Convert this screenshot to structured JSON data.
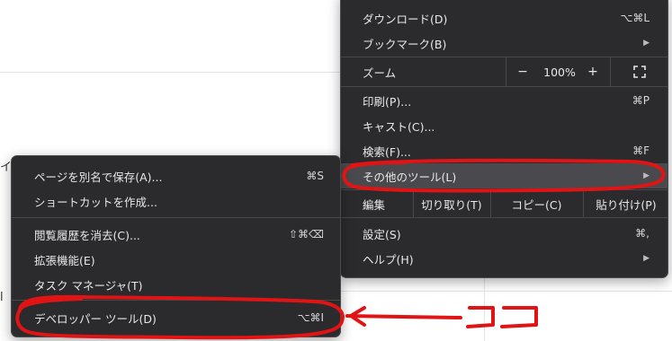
{
  "main_menu": {
    "download": {
      "label": "ダウンロード(D)",
      "shortcut": "⌥⌘L"
    },
    "bookmarks": {
      "label": "ブックマーク(B)"
    },
    "zoom": {
      "label": "ズーム",
      "minus": "−",
      "value": "100%",
      "plus": "+"
    },
    "print": {
      "label": "印刷(P)...",
      "shortcut": "⌘P"
    },
    "cast": {
      "label": "キャスト(C)..."
    },
    "search": {
      "label": "検索(F)...",
      "shortcut": "⌘F"
    },
    "more_tools": {
      "label": "その他のツール(L)"
    },
    "edit": {
      "label": "編集",
      "cut": "切り取り(T)",
      "copy": "コピー(C)",
      "paste": "貼り付け(P)"
    },
    "settings": {
      "label": "設定(S)",
      "shortcut": "⌘,"
    },
    "help": {
      "label": "ヘルプ(H)"
    }
  },
  "sub_menu": {
    "save_page": {
      "label": "ページを別名で保存(A)...",
      "shortcut": "⌘S"
    },
    "create_shortcut": {
      "label": "ショートカットを作成..."
    },
    "clear_history": {
      "label": "閲覧履歴を消去(C)...",
      "shortcut": "⇧⌘⌫"
    },
    "extensions": {
      "label": "拡張機能(E)"
    },
    "task_manager": {
      "label": "タスク マネージャ(T)"
    },
    "developer_tools": {
      "label": "デベロッパー ツール(D)",
      "shortcut": "⌥⌘I"
    }
  },
  "background": {
    "fragment_1": "イ",
    "fragment_2": "l"
  },
  "colors": {
    "menu_bg": "#2b2b2e",
    "highlight": "#4a4a4e",
    "annotation": "#e01414"
  }
}
